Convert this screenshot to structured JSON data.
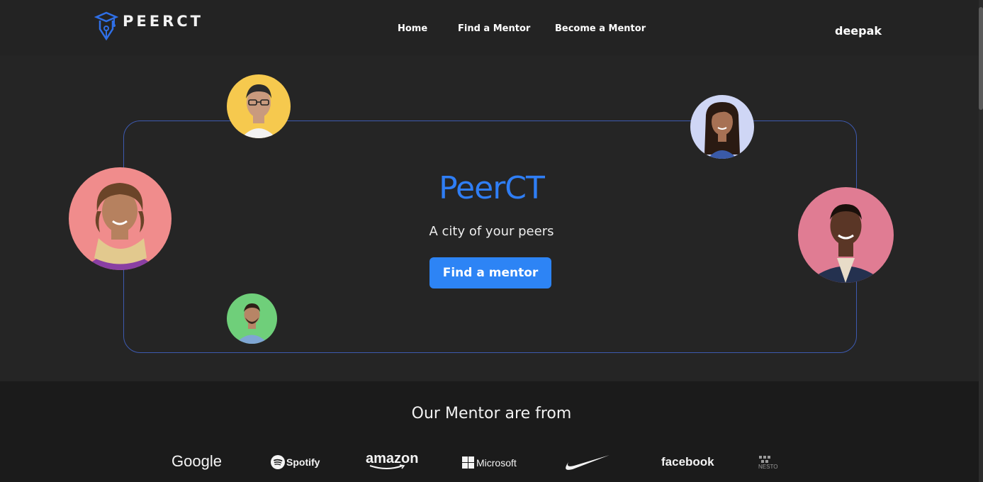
{
  "header": {
    "logo_text": "PEERCT",
    "nav": [
      {
        "label": "Home"
      },
      {
        "label": "Find a Mentor"
      },
      {
        "label": "Become a Mentor"
      }
    ],
    "user_name": "deepak"
  },
  "hero": {
    "title": "PeerCT",
    "subtitle": "A city of your peers",
    "cta_label": "Find a mentor",
    "avatars": [
      {
        "name": "mentor-avatar-woman-glasses",
        "bg": "#f6c94e"
      },
      {
        "name": "mentor-avatar-woman-scarf",
        "bg": "#f08c8c"
      },
      {
        "name": "mentor-avatar-man-blue-shirt",
        "bg": "#6fcf7a"
      },
      {
        "name": "mentor-avatar-woman-long-hair",
        "bg": "#cfd6f5"
      },
      {
        "name": "mentor-avatar-man-blazer",
        "bg": "#e07c93"
      }
    ]
  },
  "mentors_from": {
    "title": "Our Mentor are from",
    "companies": [
      {
        "name": "Google"
      },
      {
        "name": "Spotify"
      },
      {
        "name": "amazon"
      },
      {
        "name": "Microsoft"
      },
      {
        "name": "Nike"
      },
      {
        "name": "facebook"
      },
      {
        "name": "NESTO"
      }
    ]
  },
  "colors": {
    "accent": "#2d84f5",
    "title_blue": "#2f7ef5",
    "frame_border": "#3d5ab0",
    "background": "#252525",
    "footer_bg": "#1b1b1b"
  }
}
